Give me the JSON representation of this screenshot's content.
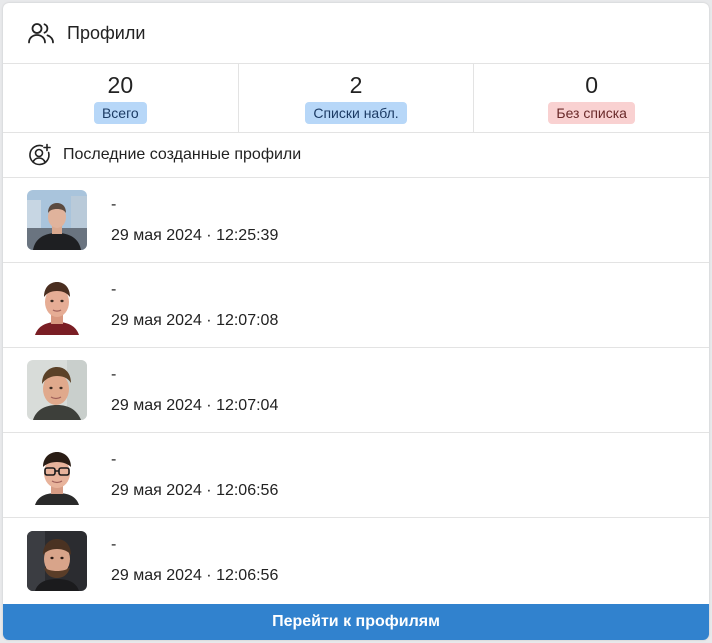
{
  "header": {
    "title": "Профили",
    "icon": "users-icon"
  },
  "stats": [
    {
      "value": "20",
      "label": "Всего",
      "color": "#b7d7f8"
    },
    {
      "value": "2",
      "label": "Списки набл.",
      "color": "#b7d7f8"
    },
    {
      "value": "0",
      "label": "Без списка",
      "color": "#f9d1d1"
    }
  ],
  "recent": {
    "title": "Последние созданные профили",
    "icon": "user-plus-icon",
    "items": [
      {
        "name": "-",
        "date": "29 мая 2024 · 12:25:39"
      },
      {
        "name": "-",
        "date": "29 мая 2024 · 12:07:08"
      },
      {
        "name": "-",
        "date": "29 мая 2024 · 12:07:04"
      },
      {
        "name": "-",
        "date": "29 мая 2024 · 12:06:56"
      },
      {
        "name": "-",
        "date": "29 мая 2024 · 12:06:56"
      }
    ]
  },
  "footer": {
    "button_label": "Перейти к профилям",
    "color": "#3182ce"
  }
}
